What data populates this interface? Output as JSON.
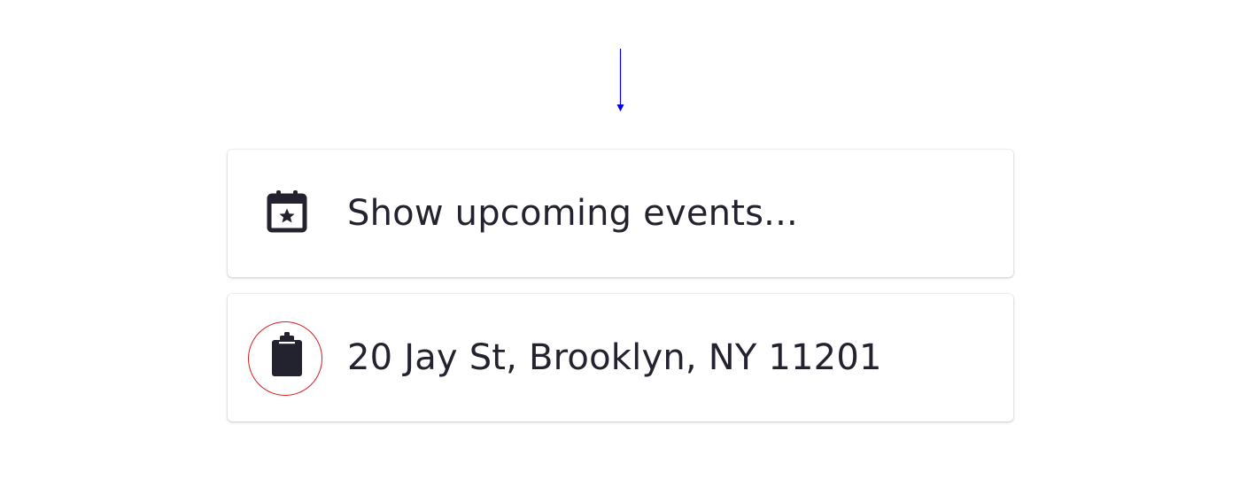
{
  "items": [
    {
      "label": "Show upcoming events...",
      "icon": "calendar-star-icon"
    },
    {
      "label": "20 Jay St, Brooklyn, NY 11201",
      "icon": "clipboard-icon"
    }
  ],
  "colors": {
    "text": "#23232f",
    "arrow": "#0000ee",
    "highlight": "#d91c1c",
    "card_background": "#ffffff"
  }
}
